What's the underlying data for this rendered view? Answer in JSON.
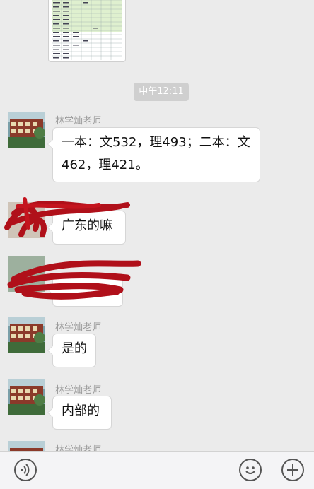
{
  "timestamp": "中午12:11",
  "messages": [
    {
      "sender": "林学灿老师",
      "text_line1": "一本：文532，理493；二本：文",
      "text_line2": "462，理421。"
    },
    {
      "sender": "",
      "text": "广东的嘛"
    },
    {
      "sender": "",
      "text": ""
    },
    {
      "sender": "林学灿老师",
      "text": "是的"
    },
    {
      "sender": "林学灿老师",
      "text": "内部的"
    },
    {
      "sender": "林学灿老师"
    }
  ],
  "icons": {
    "voice": "voice-icon",
    "emoji": "emoji-icon",
    "plus": "plus-icon"
  },
  "colors": {
    "background": "#ebebeb",
    "bubble": "#ffffff",
    "redacted": "#b0101a"
  }
}
